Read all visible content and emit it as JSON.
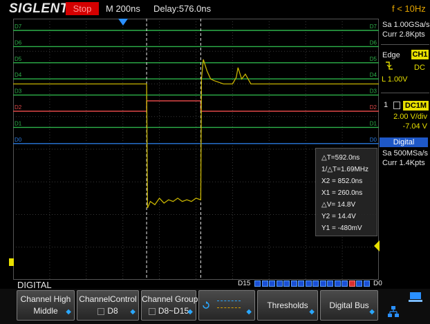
{
  "header": {
    "brand": "SIGLENT",
    "status": "Stop",
    "timebase": "M 200ns",
    "delay": "Delay:576.0ns",
    "trigger_freq": "f < 10Hz"
  },
  "acquisition": {
    "sample_rate": "Sa 1.00GSa/s",
    "memory": "Curr 2.8Kpts"
  },
  "trigger": {
    "type": "Edge",
    "source": "CH1",
    "coupling": "DC",
    "level": "L  1.00V"
  },
  "channel1": {
    "number": "1",
    "coupling_badge": "DC1M",
    "volts_div": "2.00 V/div",
    "offset": "-7.04 V"
  },
  "digital": {
    "title": "Digital",
    "sample_rate": "Sa 500MSa/s",
    "memory": "Curr 1.4Kpts"
  },
  "digital_channels": [
    {
      "label": "D7",
      "right_label": "D7",
      "color": "#2db34a",
      "high": []
    },
    {
      "label": "D6",
      "right_label": "D6",
      "color": "#2db34a",
      "high": []
    },
    {
      "label": "D5",
      "right_label": "D5",
      "color": "#2db34a",
      "high": []
    },
    {
      "label": "D4",
      "right_label": "D4",
      "color": "#2db34a",
      "high": []
    },
    {
      "label": "D3",
      "right_label": "D3",
      "color": "#2db34a",
      "high": []
    },
    {
      "label": "D2",
      "right_label": "D2",
      "color": "#e04848",
      "high": [
        [
          260,
          852
        ]
      ]
    },
    {
      "label": "D1",
      "right_label": "D1",
      "color": "#2db34a",
      "high": []
    },
    {
      "label": "D0",
      "right_label": "D0",
      "color": "#2a7ae0",
      "high": []
    }
  ],
  "measurements": {
    "delta_t": "△T=592.0ns",
    "inv_delta_t": "1/△T=1.69MHz",
    "x2": "X2 = 852.0ns",
    "x1": "X1 = 260.0ns",
    "delta_v": "△V= 14.8V",
    "y2": "Y2 = 14.4V",
    "y1": "Y1 = -480mV"
  },
  "bottom": {
    "menu_title": "DIGITAL",
    "bits_left": "D15",
    "bits_right": "D0",
    "bits": [
      "b",
      "b",
      "b",
      "b",
      "b",
      "b",
      "b",
      "b",
      "b",
      "b",
      "b",
      "b",
      "b",
      "r",
      "b",
      "b"
    ]
  },
  "buttons": [
    {
      "id": "channel-high",
      "line1": "Channel High",
      "line2": "Middle"
    },
    {
      "id": "channel-control",
      "line1": "ChannelControl",
      "line2": "D8"
    },
    {
      "id": "channel-group",
      "line1": "Channel Group",
      "line2": "D8~D15"
    },
    {
      "id": "threshold-level",
      "line1": "",
      "line2": ""
    },
    {
      "id": "thresholds",
      "line1": "Thresholds",
      "line2": ""
    },
    {
      "id": "digital-bus",
      "line1": "Digital Bus",
      "line2": ""
    }
  ],
  "chart_data": {
    "type": "line",
    "x_unit": "ns",
    "time_window": [
      -1200,
      2800
    ],
    "cursors_x": [
      260,
      852
    ],
    "analog_ch1": {
      "color": "#c8b400",
      "x": [
        -1200,
        260,
        270,
        300,
        350,
        400,
        450,
        500,
        550,
        600,
        650,
        700,
        750,
        800,
        852,
        860,
        880,
        920,
        960,
        1000,
        1100,
        1200,
        1240,
        1260,
        1300,
        1340,
        1400,
        1500,
        1700,
        2000,
        2400,
        2800
      ],
      "y": [
        0.0,
        0.0,
        -7.6,
        -7.2,
        -7.4,
        -7.0,
        -7.3,
        -7.1,
        -7.2,
        -7.0,
        -7.2,
        -7.1,
        -7.2,
        -7.0,
        -7.1,
        0.3,
        1.5,
        0.8,
        0.3,
        0.2,
        0.0,
        0.0,
        0.4,
        1.0,
        0.3,
        0.6,
        0.0,
        0.0,
        0.0,
        0.0,
        0.0,
        0.0
      ],
      "ylim": [
        -12,
        4
      ]
    }
  }
}
